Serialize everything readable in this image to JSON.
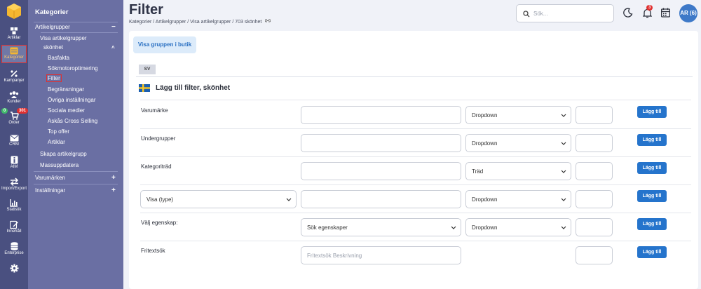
{
  "rail": {
    "items": [
      {
        "label": "Artiklar",
        "icon": "cube-icon"
      },
      {
        "label": "Kategorier",
        "icon": "list-icon"
      },
      {
        "label": "Kampanjer",
        "icon": "percent-icon"
      },
      {
        "label": "Kunder",
        "icon": "users-icon"
      },
      {
        "label": "Order",
        "icon": "cart-icon"
      },
      {
        "label": "CRM",
        "icon": "mail-icon"
      },
      {
        "label": "AIM",
        "icon": "info-icon"
      },
      {
        "label": "Import/Export",
        "icon": "transfer-icon"
      },
      {
        "label": "Statistik",
        "icon": "chart-icon"
      },
      {
        "label": "Innehåll",
        "icon": "edit-icon"
      },
      {
        "label": "Enterprise",
        "icon": "database-icon"
      }
    ],
    "kunder_badge": "0",
    "order_badge": "301",
    "settings_icon": "gear-icon"
  },
  "sidebar": {
    "title": "Kategorier",
    "artikelgrupper": "Artikelgrupper",
    "visa_artikelgrupper": "Visa artikelgrupper",
    "skonhet": "skönhet",
    "sub": [
      "Basfakta",
      "Sökmotoroptimering",
      "Filter",
      "Begränsningar",
      "Övriga inställningar",
      "Sociala medier",
      "Askås Cross Selling",
      "Top offer",
      "Artiklar"
    ],
    "skapa": "Skapa artikelgrupp",
    "mass": "Massuppdatera",
    "varumarken": "Varumärken",
    "installningar": "Inställningar",
    "minus": "−",
    "caret": "^",
    "plus": "+"
  },
  "header": {
    "title": "Filter",
    "breadcrumb": "Kategorier / Artikelgrupper / Visa artikelgrupper / 703 skönhet",
    "search_placeholder": "Sök...",
    "notif_count": "3",
    "avatar": "AR (6)"
  },
  "content": {
    "show_in_shop": "Visa gruppen i butik",
    "lang_tab": "SV",
    "section_title": "Lägg till filter, skönhet",
    "add_label": "Lägg till",
    "rows": [
      {
        "label": "Varumärke",
        "select": "Dropdown"
      },
      {
        "label": "Undergrupper",
        "select": "Dropdown"
      },
      {
        "label": "Kategoriträd",
        "select": "Träd"
      },
      {
        "label": "Visa (type)",
        "select": "Dropdown"
      },
      {
        "label": "Välj egenskap:",
        "select": "Dropdown",
        "prop_select": "Sök egenskaper"
      },
      {
        "label": "Fritextsök",
        "placeholder": "Fritextsök Beskrivning"
      }
    ]
  },
  "colors": {
    "rail": "#4a5080",
    "sidebar": "#6a6fa3",
    "accent": "#2574cc",
    "badge_red": "#e03030",
    "badge_green": "#3fb86a"
  }
}
